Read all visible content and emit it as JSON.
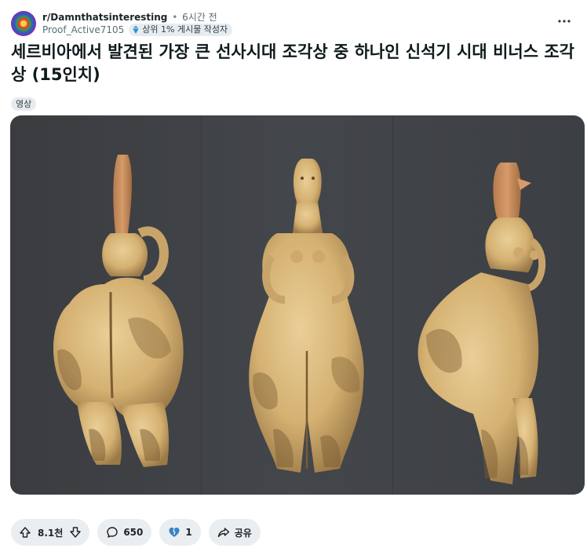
{
  "post": {
    "subreddit": "r/Damnthatsinteresting",
    "separator": "•",
    "time_ago": "6시간 전",
    "username": "Proof_Active7105",
    "flair": "상위 1% 게시물 작성자",
    "title": "세르비아에서 발견된 가장 큰 선사시대 조각상 중 하나인 신석기 시대 비너스 조각상 (15인치)",
    "tag": "영상",
    "more_icon": "more-horizontal-icon"
  },
  "actions": {
    "vote_count": "8.1천",
    "comments": "650",
    "awards": "1",
    "share": "공유"
  },
  "colors": {
    "media_background": "#3b3e42",
    "figure_clay": "#d9b77a",
    "figure_shadow": "#8a6a3e",
    "pill_background": "#eaeef0"
  }
}
